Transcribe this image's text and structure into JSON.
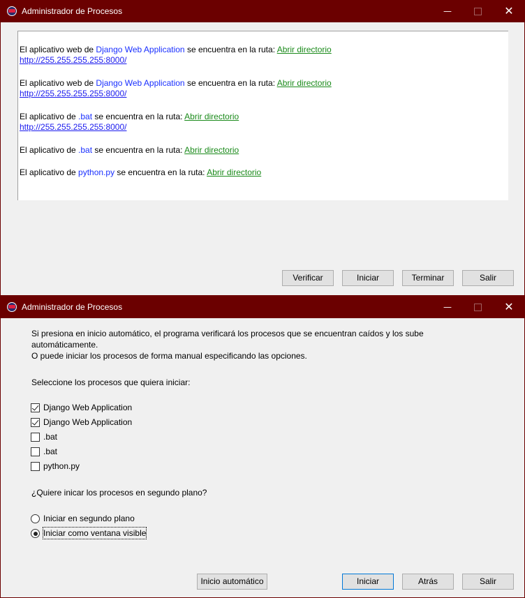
{
  "window1": {
    "title": "Administrador de Procesos",
    "controls": {
      "minimize": "—",
      "close": "✕"
    },
    "log": [
      {
        "prefix": "El aplicativo web de ",
        "app": "Django Web Application",
        "middle": " se encuentra en la ruta: ",
        "link": "Abrir directorio",
        "url": "http://255.255.255.255:8000/"
      },
      {
        "prefix": "El aplicativo web de ",
        "app": "Django Web Application",
        "middle": " se encuentra en la ruta: ",
        "link": "Abrir directorio",
        "url": "http://255.255.255.255:8000/"
      },
      {
        "prefix": "El aplicativo de ",
        "app": ".bat",
        "middle": " se encuentra en la ruta: ",
        "link": "Abrir directorio",
        "url": "http://255.255.255.255:8000/"
      },
      {
        "prefix": "El aplicativo de ",
        "app": ".bat",
        "middle": " se encuentra en la ruta: ",
        "link": "Abrir directorio"
      },
      {
        "prefix": "El aplicativo de ",
        "app": "python.py",
        "middle": " se encuentra en la ruta: ",
        "link": "Abrir directorio"
      }
    ],
    "buttons": {
      "verificar": "Verificar",
      "iniciar": "Iniciar",
      "terminar": "Terminar",
      "salir": "Salir"
    }
  },
  "window2": {
    "title": "Administrador de Procesos",
    "controls": {
      "minimize": "—",
      "close": "✕"
    },
    "intro_line1": "Si presiona en inicio automático, el programa verificará los procesos que se encuentran caídos y los sube",
    "intro_line2": "automáticamente.",
    "intro_line3": "O puede iniciar los procesos de forma manual especificando las opciones.",
    "select_prompt": "Seleccione los procesos que quiera iniciar:",
    "processes": [
      {
        "label": "Django Web Application",
        "checked": true
      },
      {
        "label": "Django Web Application",
        "checked": true
      },
      {
        "label": ".bat",
        "checked": false
      },
      {
        "label": ".bat",
        "checked": false
      },
      {
        "label": "python.py",
        "checked": false
      }
    ],
    "background_question": "¿Quiere inicar los procesos en segundo plano?",
    "run_options": [
      {
        "label": "Iniciar en segundo plano",
        "selected": false
      },
      {
        "label": "Iniciar como ventana visible",
        "selected": true
      }
    ],
    "buttons": {
      "auto": "Inicio automático",
      "iniciar": "Iniciar",
      "atras": "Atrás",
      "salir": "Salir"
    }
  }
}
